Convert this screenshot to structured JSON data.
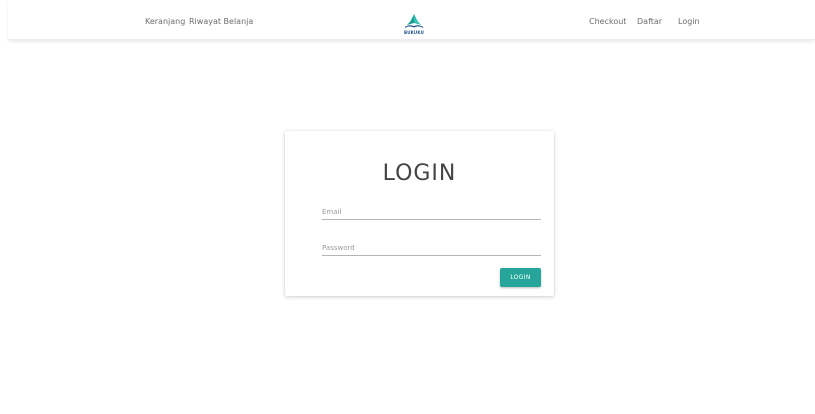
{
  "nav": {
    "left_links": [
      "Keranjang",
      "Riwayat Belanja"
    ],
    "brand_name": "BUKUKU",
    "right_links": [
      "Checkout",
      "Daftar",
      "Login"
    ]
  },
  "login_card": {
    "title": "LOGIN",
    "email_placeholder": "Email",
    "email_value": "",
    "password_placeholder": "Password",
    "password_value": "",
    "submit_label": "LOGIN"
  },
  "colors": {
    "accent": "#26a69a",
    "brand_book": "#2bb3a6",
    "brand_text": "#1a4e8c"
  },
  "icons": {
    "brand_logo": "open-book-icon"
  }
}
